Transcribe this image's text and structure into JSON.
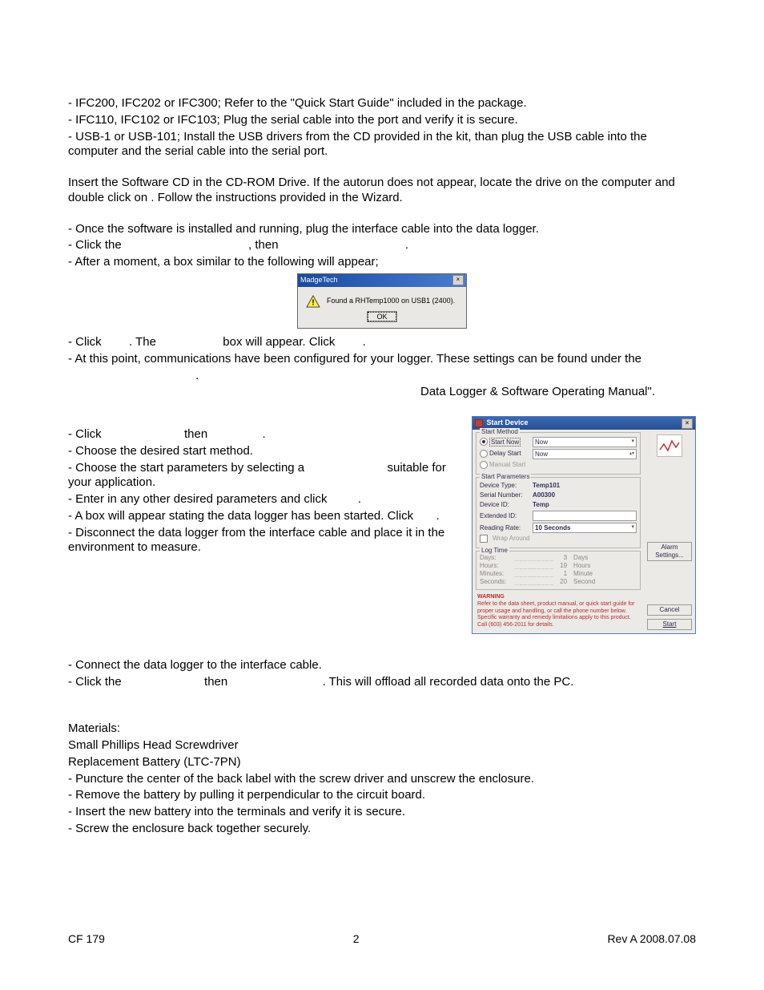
{
  "section1": {
    "l1": "- IFC200, IFC202 or IFC300; Refer to the \"Quick Start Guide\" included in the package.",
    "l2": "- IFC110, IFC102 or IFC103; Plug the serial cable into the port and verify it is secure.",
    "l3": "- USB-1 or USB-101; Install the USB drivers from the CD provided in the kit, than plug the USB cable into the computer and the serial cable into the serial port."
  },
  "section2": {
    "l1": "Insert the Software CD in the CD-ROM Drive. If the autorun does not appear, locate the drive on the computer and double click on                           . Follow the instructions provided in the Wizard."
  },
  "section3": {
    "l1": "- Once the software is installed and running, plug the interface cable into the data logger.",
    "l2_a": "- Click the ",
    "l2_b": ", then ",
    "l2_c": ".",
    "l3": "- After a moment, a box similar to the following will appear;"
  },
  "dlg1": {
    "title": "MadgeTech",
    "msg": "Found a RHTemp1000 on USB1 (2400).",
    "ok": "OK"
  },
  "section4": {
    "l1_a": "- Click ",
    "l1_b": ". The ",
    "l1_c": " box will appear. Click ",
    "l1_d": ".",
    "l2": "- At this point, communications have been configured for your logger. These settings can be found under the",
    "l3": ".",
    "l4": "Data Logger & Software Operating Manual\"."
  },
  "section5": {
    "l1_a": "- Click ",
    "l1_b": " then ",
    "l1_c": ".",
    "l2": "- Choose the desired start method.",
    "l3_a": "- Choose the start parameters by selecting a ",
    "l3_b": " suitable for your application.",
    "l4_a": "- Enter in any other desired parameters and click ",
    "l4_b": ".",
    "l5_a": "- A box will appear stating the data logger has been started. Click ",
    "l5_b": ".",
    "l6": "- Disconnect the data logger from the interface cable and place it in the environment to measure."
  },
  "dlg2": {
    "title": "Start Device",
    "start_method": {
      "group": "Start Method",
      "opt1": "Start Now",
      "opt2": "Delay Start",
      "opt3": "Manual Start",
      "now": "Now"
    },
    "start_params": {
      "group": "Start Parameters",
      "device_type_lbl": "Device Type:",
      "device_type_val": "Temp101",
      "serial_lbl": "Serial Number:",
      "serial_val": "A00300",
      "device_id_lbl": "Device ID:",
      "device_id_val": "Temp",
      "ext_id_lbl": "Extended ID:",
      "rate_lbl": "Reading Rate:",
      "rate_val": "10 Seconds",
      "wrap_lbl": "Wrap Around"
    },
    "log_time": {
      "group": "Log Time",
      "rows": [
        {
          "k": "Days:",
          "v": "3",
          "u": "Days"
        },
        {
          "k": "Hours:",
          "v": "19",
          "u": "Hours"
        },
        {
          "k": "Minutes:",
          "v": "1",
          "u": "Minute"
        },
        {
          "k": "Seconds:",
          "v": "20",
          "u": "Second"
        }
      ]
    },
    "warning": {
      "hd": "WARNING",
      "t1": "Refer to the data sheet, product manual, or quick start guide for proper usage and handling, or call the phone number below.",
      "t2": "Specific warranty and remedy limitations apply to this product.",
      "t3": "Call (603) 456-2011 for details."
    },
    "btn_alarm": "Alarm Settings...",
    "btn_cancel": "Cancel",
    "btn_start": "Start"
  },
  "section6": {
    "l1": "- Connect the data logger to the interface cable.",
    "l2_a": "- Click the ",
    "l2_b": " then ",
    "l2_c": ". This will offload all recorded data onto the PC."
  },
  "section7": {
    "l1": "Materials:",
    "l2": "Small Phillips Head Screwdriver",
    "l3": "Replacement Battery (LTC-7PN)",
    "l4": "- Puncture the center of the back label with the screw driver and unscrew the enclosure.",
    "l5": "- Remove the battery by pulling it perpendicular to the circuit board.",
    "l6": "- Insert the new battery into the terminals and verify it is secure.",
    "l7": "- Screw the enclosure back together securely."
  },
  "footer": {
    "left": "CF 179",
    "center": "2",
    "right": "Rev A 2008.07.08"
  }
}
